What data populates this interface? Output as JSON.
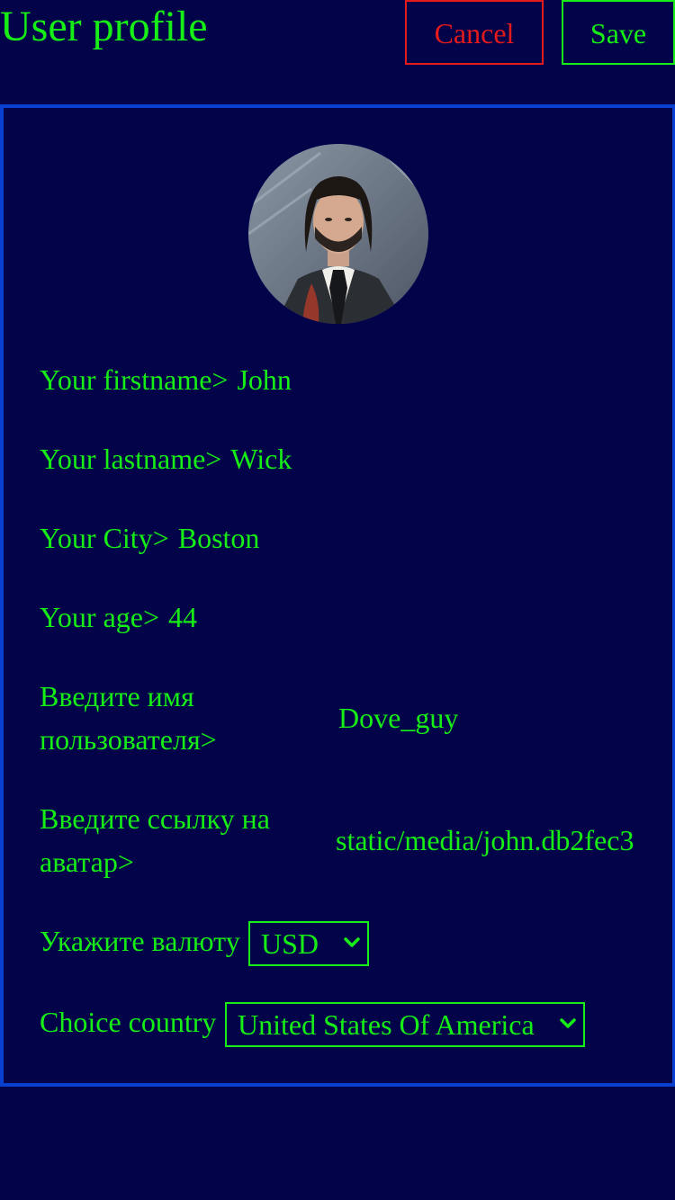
{
  "header": {
    "title": "User profile",
    "cancel_label": "Cancel",
    "save_label": "Save"
  },
  "profile": {
    "avatar_icon": "avatar-photo",
    "fields": [
      {
        "label": "Your firstname>",
        "value": "John"
      },
      {
        "label": "Your lastname>",
        "value": "Wick"
      },
      {
        "label": "Your City>",
        "value": "Boston"
      },
      {
        "label": "Your age>",
        "value": "44"
      }
    ],
    "username": {
      "label": "Введите имя пользователя>",
      "value": "Dove_guy"
    },
    "avatar_link": {
      "label": "Введите ссылку на аватар>",
      "value": "static/media/john.db2fec3"
    },
    "currency": {
      "label": "Укажите валюту",
      "selected": "USD"
    },
    "country": {
      "label": "Choice country",
      "selected": "United States Of America"
    }
  },
  "colors": {
    "background": "#03034a",
    "text": "#16ee16",
    "cancel": "#e41b1b",
    "card_border": "#0a3fd0"
  }
}
